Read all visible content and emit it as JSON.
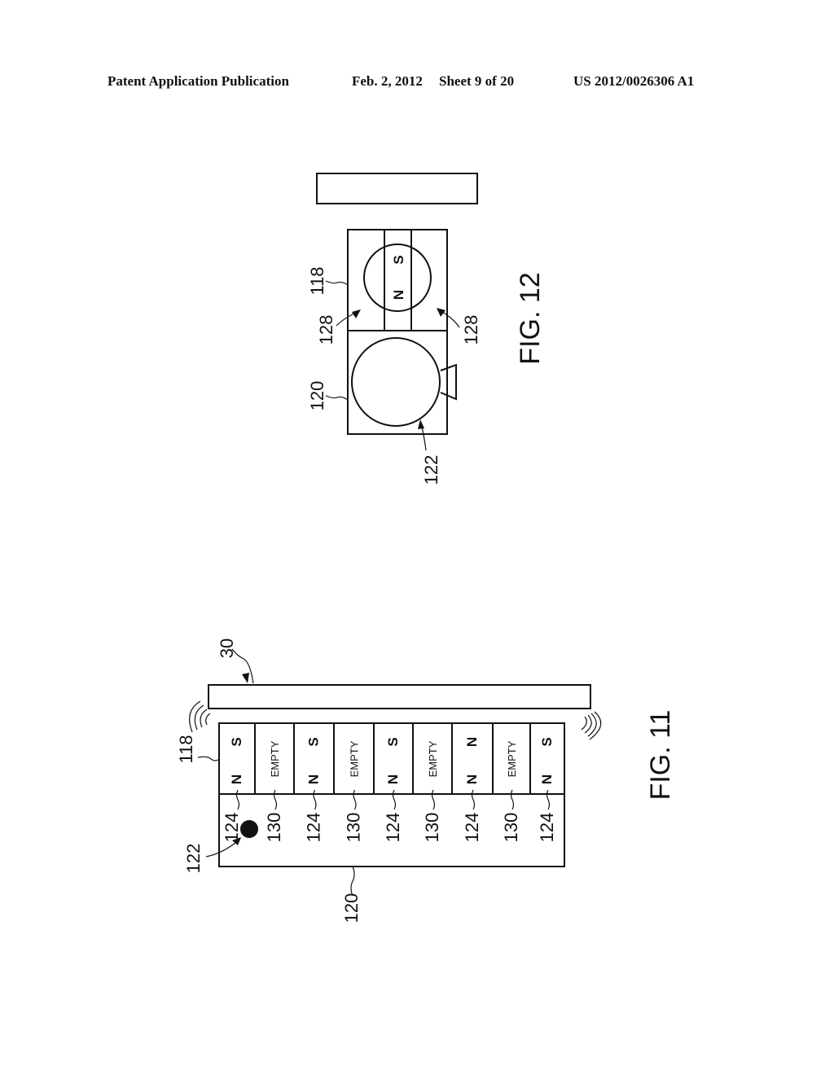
{
  "header": {
    "publication": "Patent Application Publication",
    "date": "Feb. 2, 2012",
    "sheet": "Sheet 9 of 20",
    "patent_number": "US 2012/0026306 A1"
  },
  "fig12": {
    "caption": "FIG. 12",
    "refs": {
      "housing_top": "118",
      "housing_bottom": "120",
      "bearing_left": "128",
      "bearing_right": "128",
      "ball": "122"
    },
    "magnet_poles": [
      "N",
      "S"
    ]
  },
  "fig11": {
    "caption": "FIG. 11",
    "refs": {
      "plate": "30",
      "housing_top": "118",
      "housing_bottom": "120",
      "ball": "122"
    },
    "cells": [
      {
        "type": "magnet",
        "poles": [
          "N",
          "S"
        ],
        "ref": "124"
      },
      {
        "type": "empty",
        "label": "EMPTY",
        "ref": "130"
      },
      {
        "type": "magnet",
        "poles": [
          "N",
          "S"
        ],
        "ref": "124"
      },
      {
        "type": "empty",
        "label": "EMPTY",
        "ref": "130"
      },
      {
        "type": "magnet",
        "poles": [
          "N",
          "S"
        ],
        "ref": "124"
      },
      {
        "type": "empty",
        "label": "EMPTY",
        "ref": "130"
      },
      {
        "type": "magnet",
        "poles": [
          "N",
          "N"
        ],
        "ref": "124"
      },
      {
        "type": "empty",
        "label": "EMPTY",
        "ref": "130"
      },
      {
        "type": "magnet",
        "poles": [
          "N",
          "S"
        ],
        "ref": "124"
      }
    ]
  }
}
